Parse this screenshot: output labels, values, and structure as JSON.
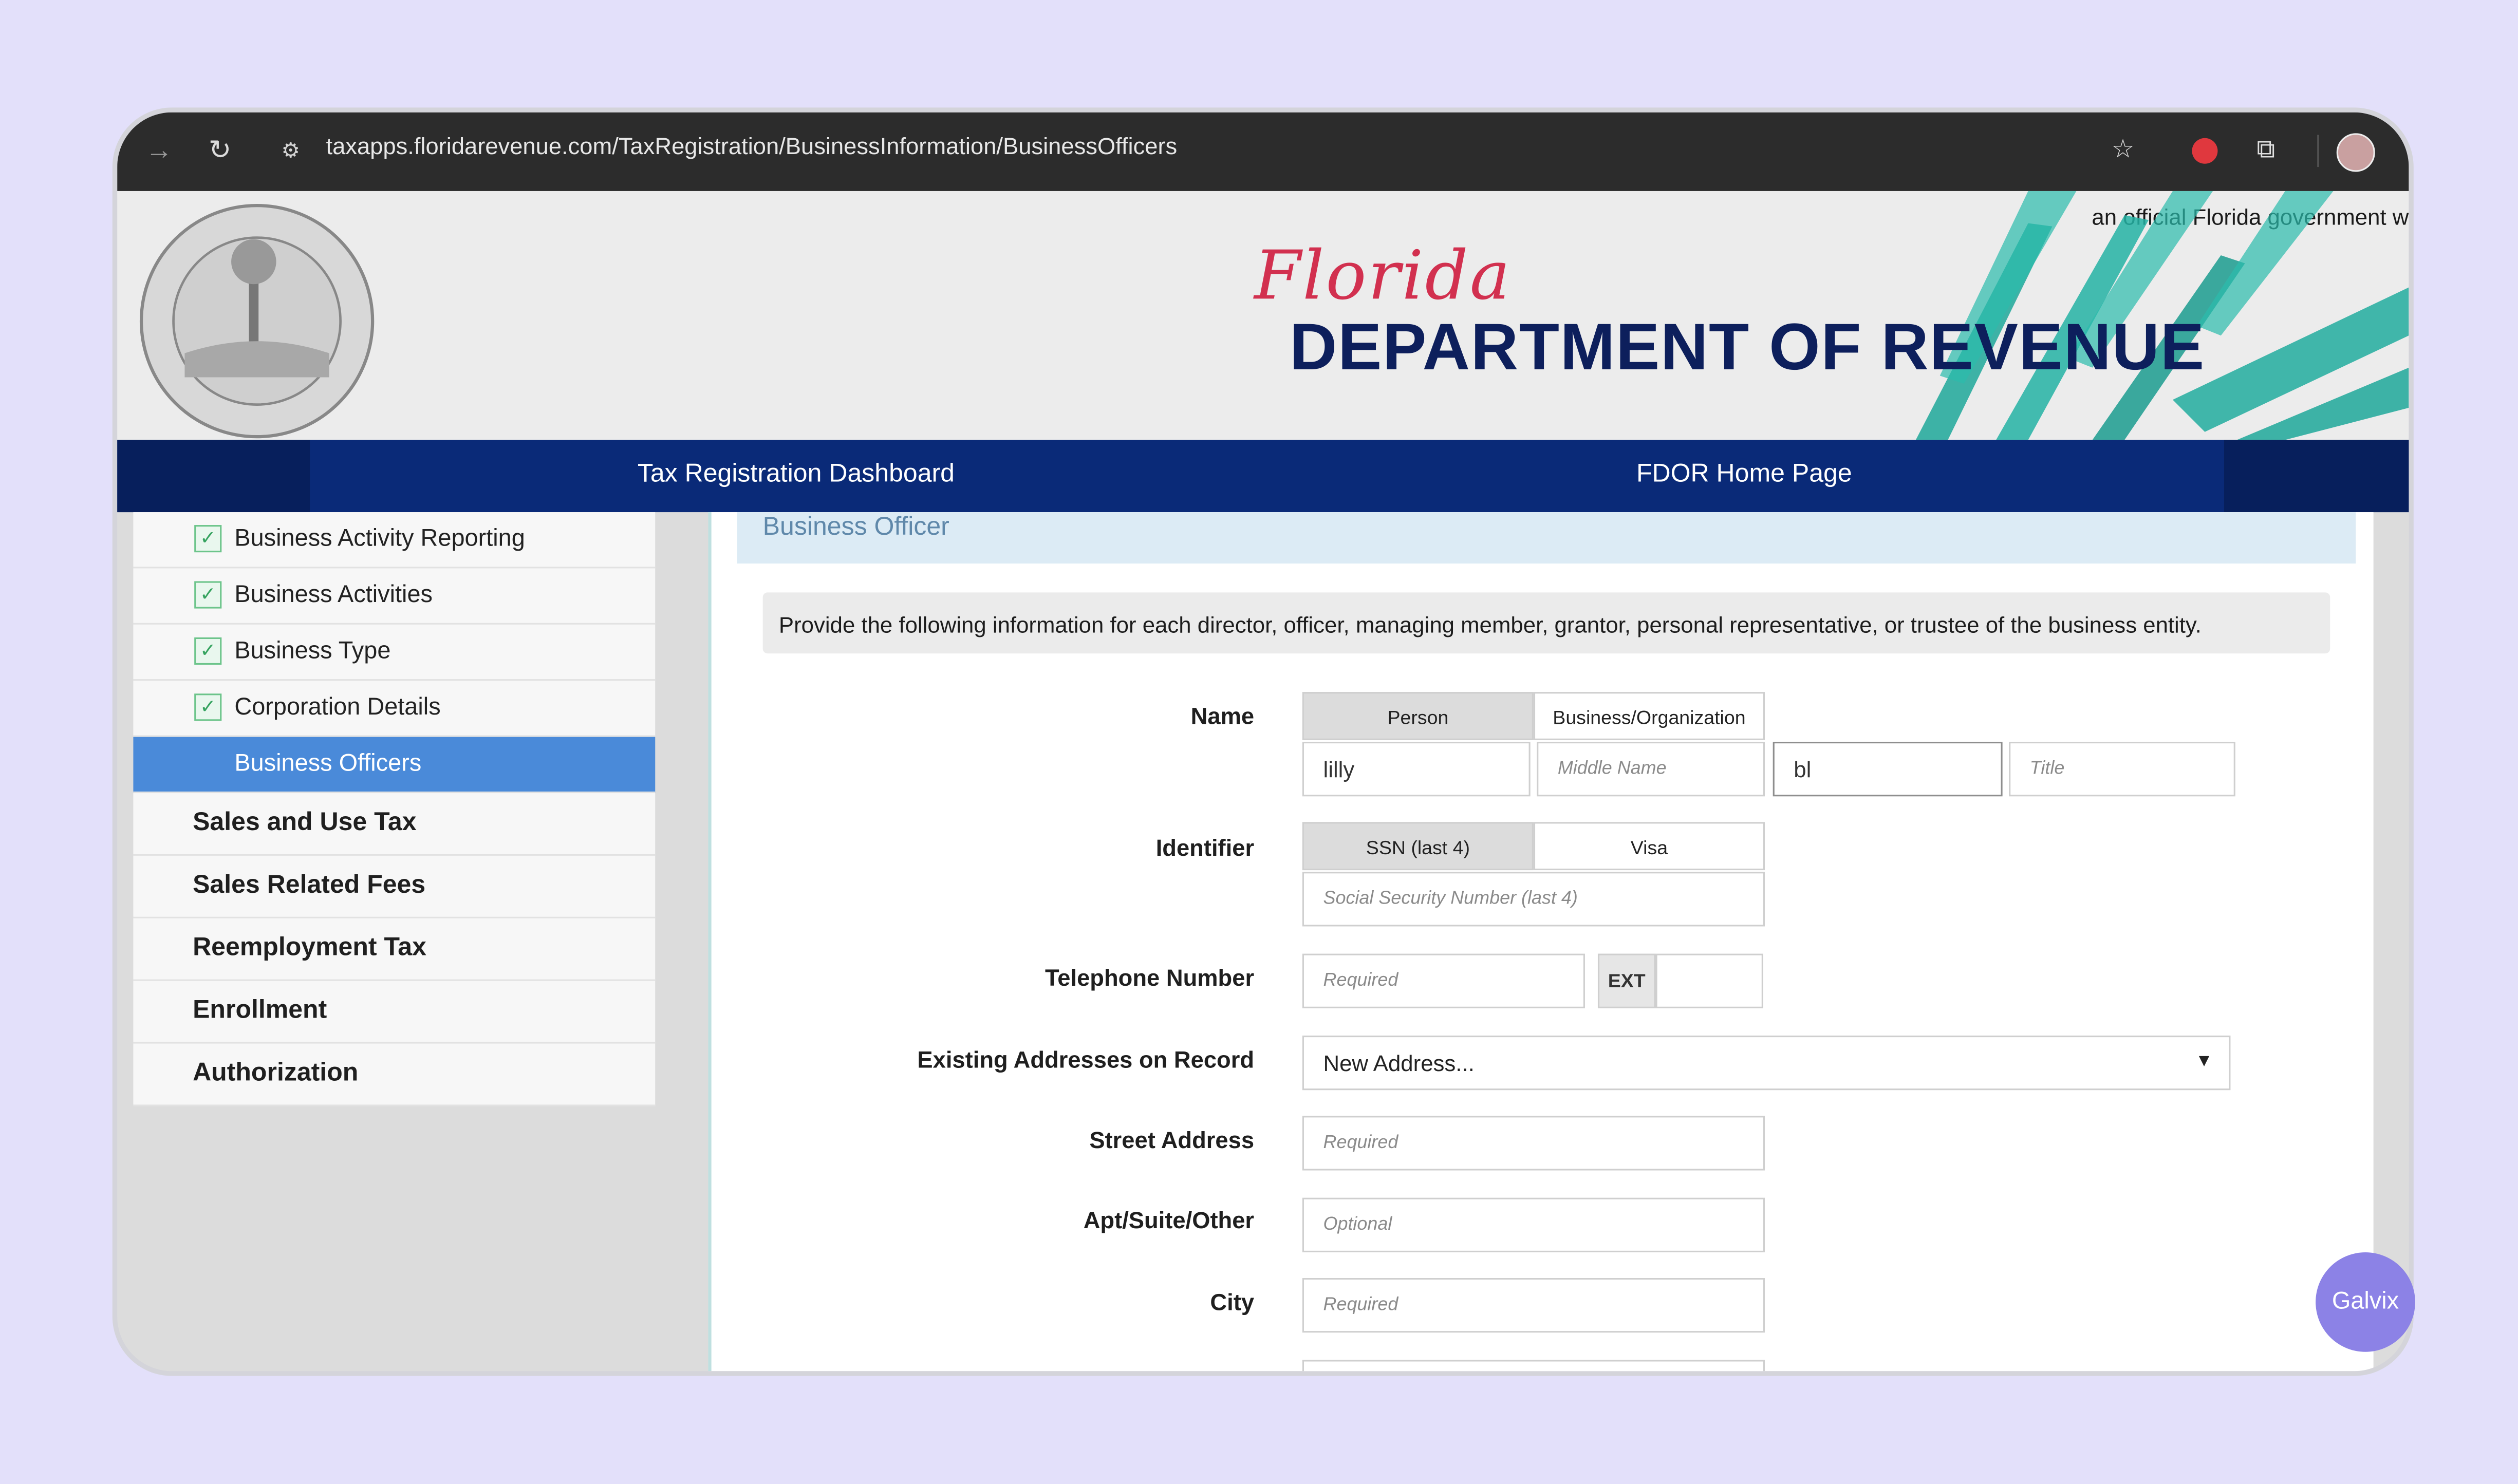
{
  "browser": {
    "url": "taxapps.floridarevenue.com/TaxRegistration/BusinessInformation/BusinessOfficers"
  },
  "header": {
    "official_note": "an official Florida government w",
    "logo_script": "Florida",
    "logo_title": "DEPARTMENT OF REVENUE"
  },
  "nav": {
    "dashboard": "Tax Registration Dashboard",
    "home": "FDOR Home Page"
  },
  "sidebar": {
    "sub_items": [
      {
        "label": "Business Activity Reporting",
        "checked": true
      },
      {
        "label": "Business Activities",
        "checked": true
      },
      {
        "label": "Business Type",
        "checked": true
      },
      {
        "label": "Corporation Details",
        "checked": true
      },
      {
        "label": "Business Officers",
        "checked": false,
        "active": true
      }
    ],
    "sections": [
      "Sales and Use Tax",
      "Sales Related Fees",
      "Reemployment Tax",
      "Enrollment",
      "Authorization"
    ]
  },
  "form": {
    "title": "Business Officer",
    "intro": "Provide the following information for each director, officer, managing member, grantor, personal representative, or trustee of the business entity.",
    "name": {
      "label": "Name",
      "tab_person": "Person",
      "tab_business": "Business/Organization",
      "first_value": "lilly",
      "middle_placeholder": "Middle Name",
      "last_value": "bl",
      "title_placeholder": "Title"
    },
    "identifier": {
      "label": "Identifier",
      "tab_ssn": "SSN (last 4)",
      "tab_visa": "Visa",
      "ssn_placeholder": "Social Security Number (last 4)"
    },
    "telephone": {
      "label": "Telephone Number",
      "placeholder": "Required",
      "ext_label": "EXT"
    },
    "existing_addresses": {
      "label": "Existing Addresses on Record",
      "selected": "New Address..."
    },
    "street": {
      "label": "Street Address",
      "placeholder": "Required"
    },
    "apt": {
      "label": "Apt/Suite/Other",
      "placeholder": "Optional"
    },
    "city": {
      "label": "City",
      "placeholder": "Required"
    }
  },
  "badge": {
    "label": "Galvix"
  }
}
